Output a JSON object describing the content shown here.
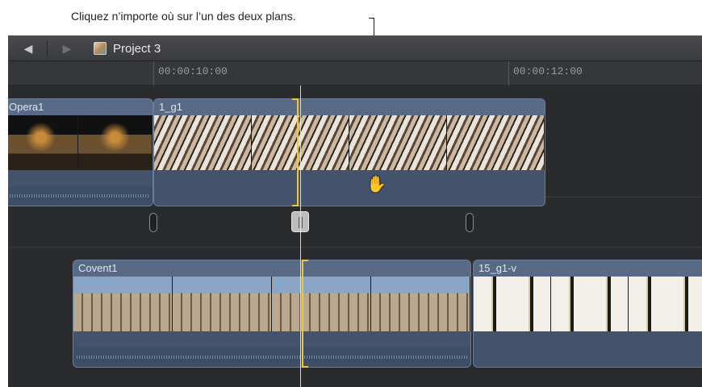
{
  "annotation": {
    "text": "Cliquez n’importe où sur l’un des deux plans."
  },
  "toolbar": {
    "back_icon": "left-triangle-icon",
    "forward_icon": "right-triangle-icon",
    "project_name": "Project 3"
  },
  "ruler": {
    "timecodes": [
      "00:00:10:00",
      "00:00:12:00"
    ]
  },
  "clips": {
    "opera": {
      "name": "Opera1"
    },
    "g1": {
      "name": "1_g1"
    },
    "covent": {
      "name": "Covent1"
    },
    "g15": {
      "name": "15_g1-v"
    }
  },
  "colors": {
    "accent_selection": "#f2c531",
    "clip_blue": "#43536b",
    "background": "#2d2e30"
  }
}
